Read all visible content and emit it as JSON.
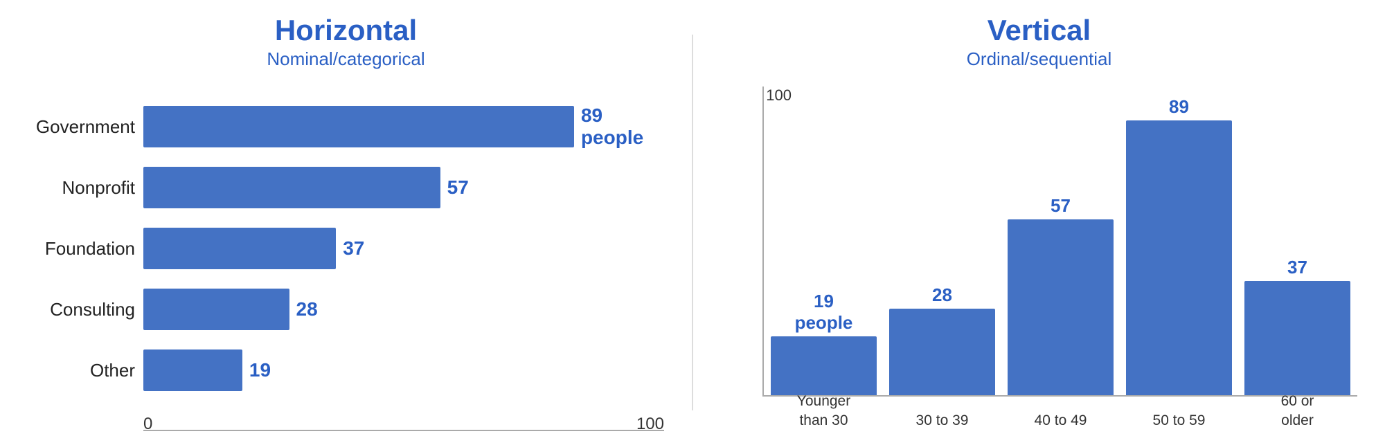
{
  "left": {
    "title": "Horizontal",
    "subtitle": "Nominal/categorical",
    "bars": [
      {
        "label": "Government",
        "value": 89,
        "display": "89 people",
        "pct": 89
      },
      {
        "label": "Nonprofit",
        "value": 57,
        "display": "57",
        "pct": 57
      },
      {
        "label": "Foundation",
        "value": 37,
        "display": "37",
        "pct": 37
      },
      {
        "label": "Consulting",
        "value": 28,
        "display": "28",
        "pct": 28
      },
      {
        "label": "Other",
        "value": 19,
        "display": "19",
        "pct": 19
      }
    ],
    "axis": {
      "min": "0",
      "max": "100"
    }
  },
  "right": {
    "title": "Vertical",
    "subtitle": "Ordinal/sequential",
    "bars": [
      {
        "label": "Younger\nthan 30",
        "value": 19,
        "display": "19\npeople",
        "pct": 19
      },
      {
        "label": "30 to 39",
        "value": 28,
        "display": "28",
        "pct": 28
      },
      {
        "label": "40 to 49",
        "value": 57,
        "display": "57",
        "pct": 57
      },
      {
        "label": "50 to 59",
        "value": 89,
        "display": "89",
        "pct": 89
      },
      {
        "label": "60 or\nolder",
        "value": 37,
        "display": "37",
        "pct": 37
      }
    ],
    "yAxis": {
      "min": "0",
      "max": "100"
    }
  },
  "colors": {
    "bar": "#4472c4",
    "title": "#2a5fc4",
    "label": "#222",
    "axis": "#333"
  }
}
